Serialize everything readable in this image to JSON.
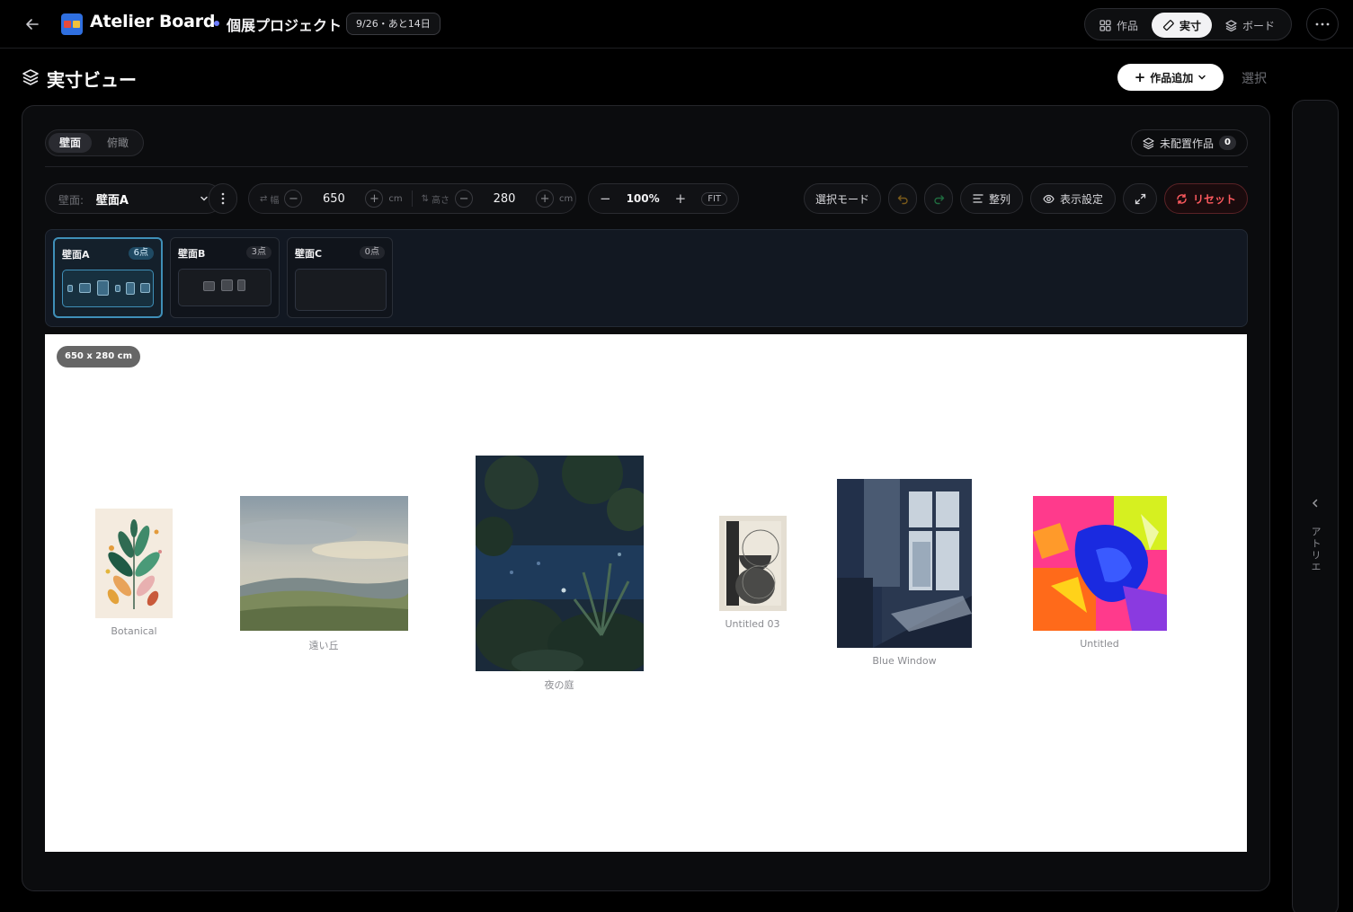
{
  "header": {
    "app_title": "Atelier Board",
    "project_name": "個展プロジェクト",
    "date_badge": "9/26・あと14日",
    "views": [
      {
        "label": "作品",
        "icon": "grid-icon"
      },
      {
        "label": "実寸",
        "icon": "ruler-icon",
        "active": true
      },
      {
        "label": "ボード",
        "icon": "layers-icon"
      }
    ]
  },
  "page": {
    "title": "実寸ビュー",
    "add_button": "作品追加",
    "select_link": "選択"
  },
  "panel": {
    "segments": [
      "壁面",
      "俯瞰"
    ],
    "unplaced_label": "未配置作品",
    "unplaced_count": "0",
    "wall_select_label": "壁面:",
    "wall_select_value": "壁面A",
    "width_label": "幅",
    "width_value": "650",
    "height_label": "高さ",
    "height_value": "280",
    "unit": "cm",
    "zoom_value": "100%",
    "fit_label": "FIT",
    "select_mode": "選択モード",
    "align": "整列",
    "display_settings": "表示設定",
    "reset": "リセット"
  },
  "walls": [
    {
      "name": "壁面A",
      "count": "6点",
      "active": true
    },
    {
      "name": "壁面B",
      "count": "3点"
    },
    {
      "name": "壁面C",
      "count": "0点"
    }
  ],
  "canvas": {
    "size_badge": "650 x 280 cm",
    "artworks": [
      {
        "title": "Botanical"
      },
      {
        "title": "遠い丘"
      },
      {
        "title": "夜の庭"
      },
      {
        "title": "Untitled 03"
      },
      {
        "title": "Blue Window"
      },
      {
        "title": "Untitled"
      }
    ]
  },
  "sidebar": {
    "label": "アトリエ"
  },
  "colors": {
    "accent": "#3f8fb8",
    "reset": "#ff5a5f",
    "canvas": "#ffffff"
  }
}
